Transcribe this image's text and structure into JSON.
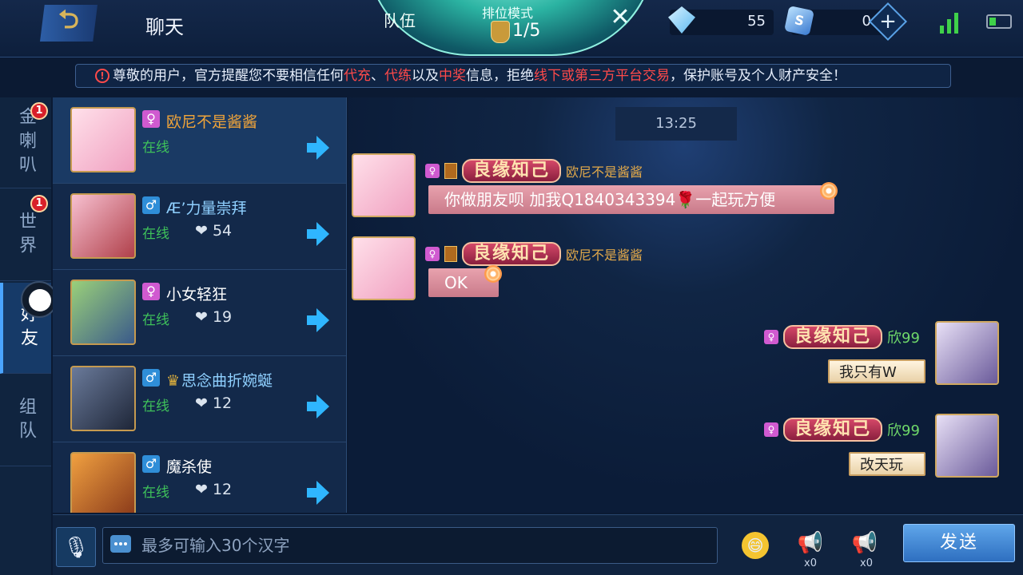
{
  "header": {
    "back_glyph": "⮌",
    "title": "聊天",
    "team_tab": "队伍",
    "mode_label": "排位模式",
    "mode_count": "1/5",
    "close_glyph": "✕",
    "diamonds": "55",
    "coins": "0",
    "coin_glyph": "S",
    "add_glyph": "+"
  },
  "notice": {
    "icon_glyph": "!",
    "parts": [
      "尊敬的用户，官方提醒您不要相信任何",
      "代充",
      "、",
      "代练",
      "以及",
      "中奖",
      "信息，拒绝",
      "线下或第三方平台交易",
      "，保护账号及个人财产安全！"
    ]
  },
  "tabs": [
    {
      "label": "金喇叭",
      "badge": "1"
    },
    {
      "label": "世界",
      "badge": "1"
    },
    {
      "label": "好友"
    },
    {
      "label": "组队"
    }
  ],
  "friends": [
    {
      "gender": "♀",
      "name": "欧尼不是酱酱",
      "status": "在线",
      "likes": "",
      "name_color": "#f0a43a"
    },
    {
      "gender": "♂",
      "name": "Æ’力量崇拜",
      "status": "在线",
      "likes": "❤ 54",
      "name_color": "#8fd0ff"
    },
    {
      "gender": "♀",
      "name": "小女轻狂",
      "status": "在线",
      "likes": "❤ 19",
      "name_color": "#ffffff"
    },
    {
      "gender": "♂",
      "name": "思念曲折婉蜒",
      "status": "在线",
      "likes": "❤ 12",
      "name_color": "#8fd0ff",
      "crown": "♛"
    },
    {
      "gender": "♂",
      "name": "魔杀使",
      "status": "在线",
      "likes": "❤ 12",
      "name_color": "#ffffff"
    }
  ],
  "chat": {
    "time": "13:25",
    "messages": [
      {
        "gender": "♀",
        "title": "良缘知己",
        "sender": "欧尼不是酱酱",
        "text": "你做朋友呗 加我Q1840343394🌹一起玩方便"
      },
      {
        "gender": "♀",
        "title": "良缘知己",
        "sender": "欧尼不是酱酱",
        "text": "OK"
      },
      {
        "gender": "♀",
        "title": "良缘知己",
        "sender": "欣99",
        "text": "我只有W"
      },
      {
        "gender": "♀",
        "title": "良缘知己",
        "sender": "欣99",
        "text": "改天玩"
      }
    ]
  },
  "input": {
    "voice_glyph": "🎙",
    "placeholder": "最多可输入30个汉字",
    "emoji": "😄",
    "gold_horn": "📢",
    "gold_horn_count": "x0",
    "silver_horn": "📢",
    "silver_horn_count": "x0",
    "send_label": "发送"
  }
}
